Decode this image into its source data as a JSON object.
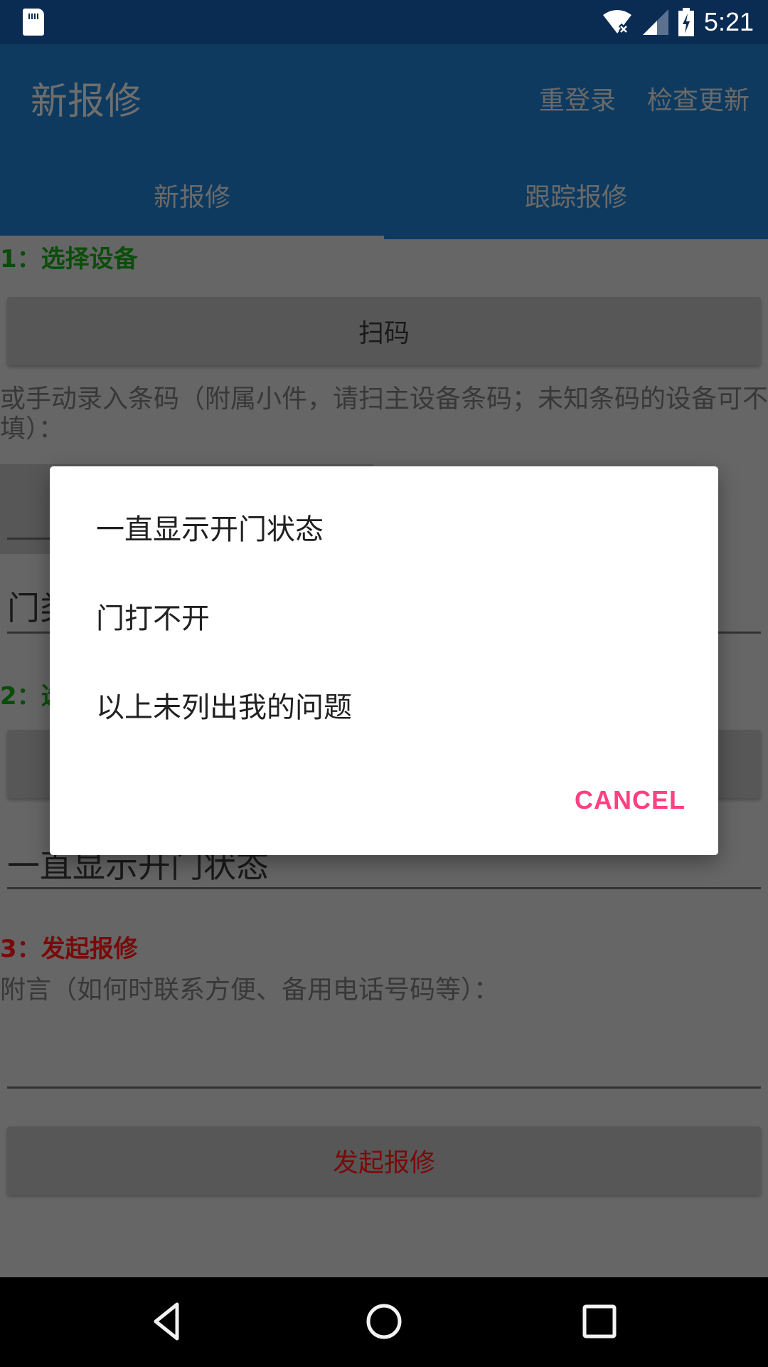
{
  "status_bar": {
    "time": "5:21",
    "icons": [
      "sd-card-icon",
      "wifi-off-icon",
      "cell-signal-icon",
      "battery-charging-icon"
    ]
  },
  "app_bar": {
    "title": "新报修",
    "menu": [
      "重登录",
      "检查更新"
    ]
  },
  "tabs": [
    {
      "label": "新报修",
      "selected": true
    },
    {
      "label": "跟踪报修",
      "selected": false
    }
  ],
  "form": {
    "step1_heading": "1：选择设备",
    "scan_button": "扫码",
    "manual_hint": "或手动录入条码（附属小件，请扫主设备条码；未知条码的设备可不填）：",
    "barcode_input_value": "",
    "category_field_value": "门类",
    "step2_heading": "2：选",
    "problem_spinner_value": "一直显示开门状态",
    "step3_heading": "3：发起报修",
    "note_hint": "附言（如何时联系方便、备用电话号码等）：",
    "note_input_value": "",
    "submit_button": "发起报修"
  },
  "dialog": {
    "options": [
      "一直显示开门状态",
      "门打不开",
      "以上未列出我的问题"
    ],
    "cancel_label": "CANCEL"
  },
  "colors": {
    "accent": "#FF4081",
    "step_green": "#0A4D0A",
    "step_red": "#7A0A0A",
    "app_bar": "#0E3A5F"
  }
}
